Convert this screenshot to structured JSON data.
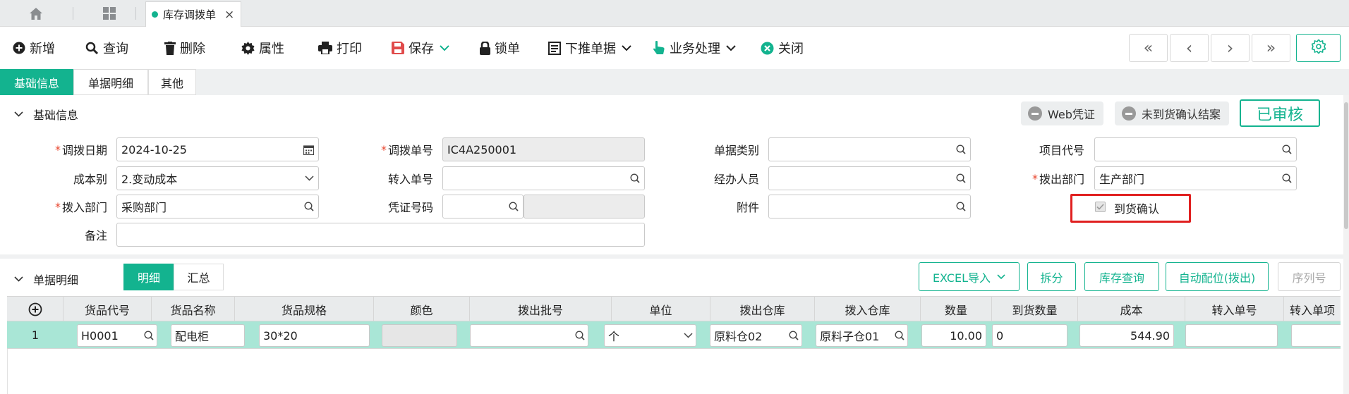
{
  "tabs": {
    "doc_tab_label": "库存调拨单",
    "close_glyph": "×"
  },
  "toolbar": {
    "new": "新增",
    "query": "查询",
    "delete": "删除",
    "properties": "属性",
    "print": "打印",
    "save": "保存",
    "lock": "锁单",
    "push_down": "下推单据",
    "business": "业务处理",
    "close": "关闭"
  },
  "nav": {
    "first": "«",
    "prev": "‹",
    "next": "›",
    "last": "»"
  },
  "subtabs": {
    "basic": "基础信息",
    "detail": "单据明细",
    "other": "其他"
  },
  "basic_section": {
    "title": "基础信息",
    "web_voucher": "Web凭证",
    "not_arrived_close": "未到货确认结案",
    "status": "已审核"
  },
  "form": {
    "transfer_date": {
      "label": "调拨日期",
      "value": "2024-10-25"
    },
    "transfer_no": {
      "label": "调拨单号",
      "value": "IC4A250001"
    },
    "doc_type": {
      "label": "单据类别",
      "value": ""
    },
    "project_code": {
      "label": "项目代号",
      "value": ""
    },
    "cost_type": {
      "label": "成本别",
      "value": "2.变动成本"
    },
    "transfer_in_no": {
      "label": "转入单号",
      "value": ""
    },
    "handler": {
      "label": "经办人员",
      "value": ""
    },
    "out_dept": {
      "label": "拨出部门",
      "value": "生产部门"
    },
    "in_dept": {
      "label": "拨入部门",
      "value": "采购部门"
    },
    "voucher_no": {
      "label": "凭证号码",
      "value": ""
    },
    "attachment": {
      "label": "附件",
      "value": ""
    },
    "arrival_confirm": {
      "label": "到货确认",
      "checked": true
    },
    "remark": {
      "label": "备注",
      "value": ""
    },
    "required_mark": "*"
  },
  "detail_section": {
    "title": "单据明细",
    "tab_detail": "明细",
    "tab_summary": "汇总",
    "excel_import": "EXCEL导入",
    "split": "拆分",
    "stock_query": "库存查询",
    "auto_allocate": "自动配位(拨出)",
    "serial_no": "序列号"
  },
  "grid": {
    "columns": [
      "货品代号",
      "货品名称",
      "货品规格",
      "颜色",
      "拨出批号",
      "单位",
      "拨出仓库",
      "拨入仓库",
      "数量",
      "到货数量",
      "成本",
      "转入单号",
      "转入单项"
    ],
    "rows": [
      {
        "index": "1",
        "item_code": "H0001",
        "item_name": "配电柜",
        "spec": "30*20",
        "color": "",
        "batch": "",
        "unit": "个",
        "out_wh": "原料仓02",
        "in_wh": "原料子仓01",
        "qty": "10.00",
        "arrived_qty": "0",
        "cost": "544.90",
        "in_no": "",
        "in_item": ""
      }
    ]
  },
  "colors": {
    "accent": "#13b38f",
    "row_highlight": "#a9e6d6",
    "required": "#e8442c",
    "highlight_box": "#e02020"
  }
}
